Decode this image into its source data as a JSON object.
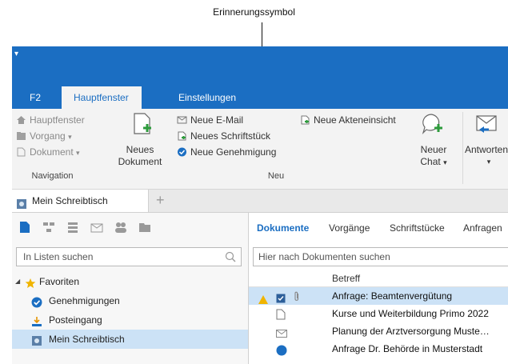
{
  "annotation": {
    "label": "Erinnerungssymbol"
  },
  "tabs": [
    {
      "label": "F2"
    },
    {
      "label": "Hauptfenster"
    },
    {
      "label": "Einstellungen"
    }
  ],
  "ribbon": {
    "navigation": {
      "items": [
        "Hauptfenster",
        "Vorgang",
        "Dokument"
      ],
      "group_label": "Navigation"
    },
    "new_document": {
      "line1": "Neues",
      "line2": "Dokument"
    },
    "neu": {
      "items": [
        "Neue E-Mail",
        "Neues Schriftstück",
        "Neue Genehmigung",
        "Neue Akteneinsicht"
      ],
      "group_label": "Neu"
    },
    "new_chat": {
      "line1": "Neuer",
      "line2": "Chat"
    },
    "reply": {
      "label": "Antworten"
    }
  },
  "doc_tab": {
    "label": "Mein Schreibtisch",
    "add": "+"
  },
  "left": {
    "search_placeholder": "In Listen suchen",
    "tree": [
      "Favoriten",
      "Genehmigungen",
      "Posteingang",
      "Mein Schreibtisch"
    ]
  },
  "right": {
    "tabs": [
      "Dokumente",
      "Vorgänge",
      "Schriftstücke",
      "Anfragen"
    ],
    "search_placeholder": "Hier nach Dokumenten suchen",
    "column_header": "Betreff",
    "rows": [
      "Anfrage: Beamtenvergütung",
      "Kurse und Weiterbildung Primo 2022",
      "Planung der Arztversorgung Muste…",
      "Anfrage Dr. Behörde in Musterstadt"
    ]
  },
  "colors": {
    "accent": "#1b6ec2",
    "selection": "#cce2f6",
    "reminder": "#f0b400"
  }
}
